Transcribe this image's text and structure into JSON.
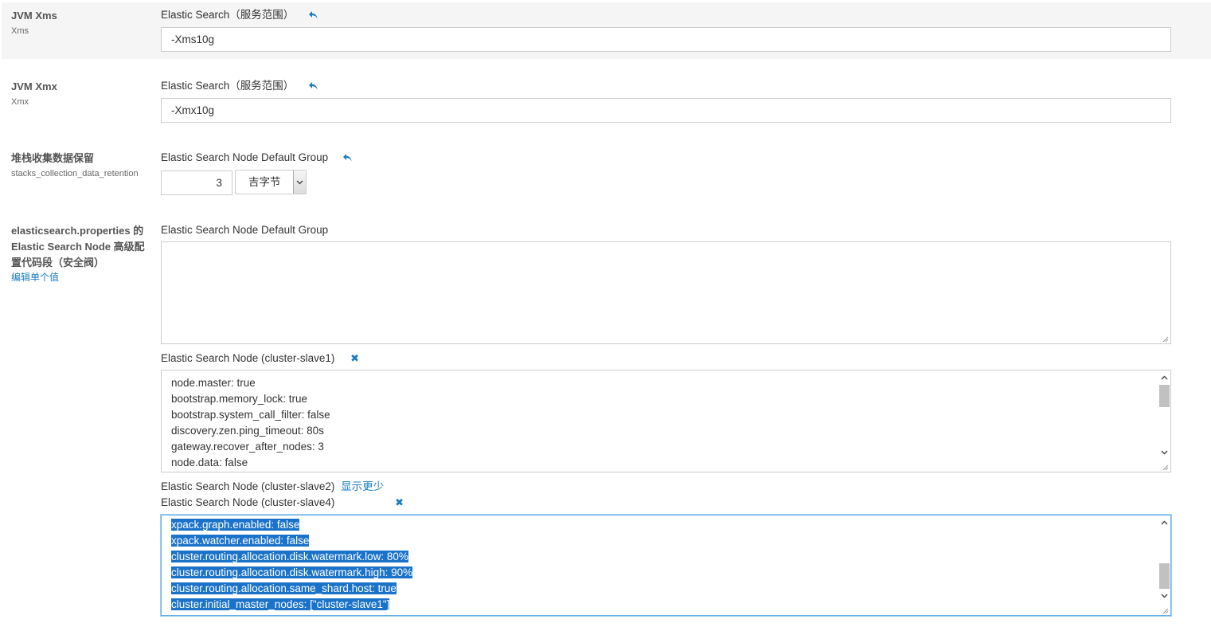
{
  "rows": {
    "xms": {
      "title": "JVM Xms",
      "subtitle": "Xms",
      "scope": "Elastic Search（服务范围）",
      "value": "-Xms10g"
    },
    "xmx": {
      "title": "JVM Xmx",
      "subtitle": "Xmx",
      "scope": "Elastic Search（服务范围）",
      "value": "-Xmx10g"
    },
    "stacks": {
      "title": "堆栈收集数据保留",
      "subtitle": "stacks_collection_data_retention",
      "scope": "Elastic Search Node Default Group",
      "value": "3",
      "unit": "吉字节"
    },
    "safety_valve": {
      "title_line1": "elasticsearch.properties 的",
      "title_line2": "Elastic Search Node 高级配",
      "title_line3": "置代码段（安全阀）",
      "edit_link": "编辑单个值",
      "default_group_scope": "Elastic Search Node Default Group",
      "default_group_value": "",
      "slave1_scope": "Elastic Search Node (cluster-slave1)",
      "slave1_lines": [
        "node.master: true",
        "bootstrap.memory_lock: true",
        "bootstrap.system_call_filter: false",
        "discovery.zen.ping_timeout: 80s",
        "gateway.recover_after_nodes: 3",
        "node.data: false"
      ],
      "slave2_scope": "Elastic Search Node (cluster-slave2)",
      "show_less": "显示更少",
      "slave4_scope": "Elastic Search Node (cluster-slave4)",
      "slave4_lines": [
        "xpack.graph.enabled: false",
        "xpack.watcher.enabled: false",
        "cluster.routing.allocation.disk.watermark.low: 80%",
        "cluster.routing.allocation.disk.watermark.high: 90%",
        "cluster.routing.allocation.same_shard.host: true",
        "cluster.initial_master_nodes: [\"cluster-slave1\"]"
      ]
    }
  },
  "icons": {
    "undo": "undo-arrow-icon",
    "remove": "close-x-icon"
  },
  "colors": {
    "accent": "#1a7bbf",
    "selection": "#1a73c9",
    "highlight_row": "#f5f5f5"
  }
}
